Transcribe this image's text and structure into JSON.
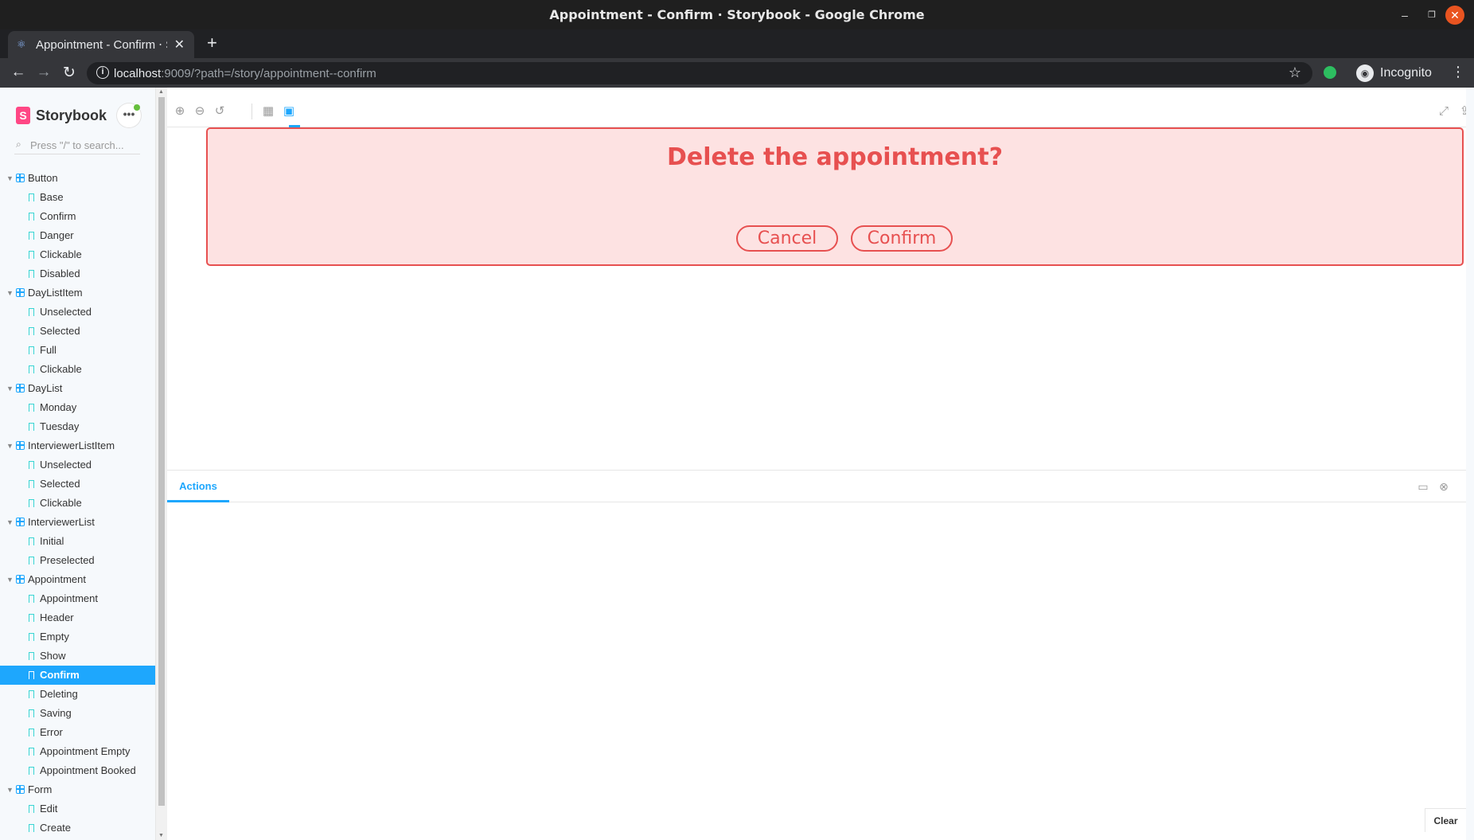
{
  "window": {
    "title": "Appointment - Confirm ⋅ Storybook - Google Chrome"
  },
  "tab": {
    "title": "Appointment - Confirm ⋅ Storybook",
    "close": "✕",
    "new_tab": "+"
  },
  "toolbar": {
    "url_host": "localhost",
    "url_rest": ":9009/?path=/story/appointment--confirm",
    "profile_label": "Incognito"
  },
  "sidebar": {
    "brand": "Storybook",
    "brand_logo": "S",
    "menu": "•••",
    "search_placeholder": "Press \"/\" to search...",
    "tree": [
      {
        "type": "group",
        "label": "Button"
      },
      {
        "type": "story",
        "label": "Base"
      },
      {
        "type": "story",
        "label": "Confirm"
      },
      {
        "type": "story",
        "label": "Danger"
      },
      {
        "type": "story",
        "label": "Clickable"
      },
      {
        "type": "story",
        "label": "Disabled"
      },
      {
        "type": "group",
        "label": "DayListItem"
      },
      {
        "type": "story",
        "label": "Unselected"
      },
      {
        "type": "story",
        "label": "Selected"
      },
      {
        "type": "story",
        "label": "Full"
      },
      {
        "type": "story",
        "label": "Clickable"
      },
      {
        "type": "group",
        "label": "DayList"
      },
      {
        "type": "story",
        "label": "Monday"
      },
      {
        "type": "story",
        "label": "Tuesday"
      },
      {
        "type": "group",
        "label": "InterviewerListItem"
      },
      {
        "type": "story",
        "label": "Unselected"
      },
      {
        "type": "story",
        "label": "Selected"
      },
      {
        "type": "story",
        "label": "Clickable"
      },
      {
        "type": "group",
        "label": "InterviewerList"
      },
      {
        "type": "story",
        "label": "Initial"
      },
      {
        "type": "story",
        "label": "Preselected"
      },
      {
        "type": "group",
        "label": "Appointment"
      },
      {
        "type": "story",
        "label": "Appointment"
      },
      {
        "type": "story",
        "label": "Header"
      },
      {
        "type": "story",
        "label": "Empty"
      },
      {
        "type": "story",
        "label": "Show"
      },
      {
        "type": "story",
        "label": "Confirm",
        "active": true
      },
      {
        "type": "story",
        "label": "Deleting"
      },
      {
        "type": "story",
        "label": "Saving"
      },
      {
        "type": "story",
        "label": "Error"
      },
      {
        "type": "story",
        "label": "Appointment Empty"
      },
      {
        "type": "story",
        "label": "Appointment Booked"
      },
      {
        "type": "group",
        "label": "Form"
      },
      {
        "type": "story",
        "label": "Edit"
      },
      {
        "type": "story",
        "label": "Create"
      }
    ]
  },
  "preview": {
    "confirm": {
      "message": "Delete the appointment?",
      "cancel_label": "Cancel",
      "confirm_label": "Confirm"
    }
  },
  "addons": {
    "tab_label": "Actions",
    "clear_label": "Clear"
  },
  "colors": {
    "accent": "#1ea7fd",
    "danger": "#e75050",
    "danger_bg": "#fde2e2",
    "storybook_pink": "#ff4785"
  }
}
